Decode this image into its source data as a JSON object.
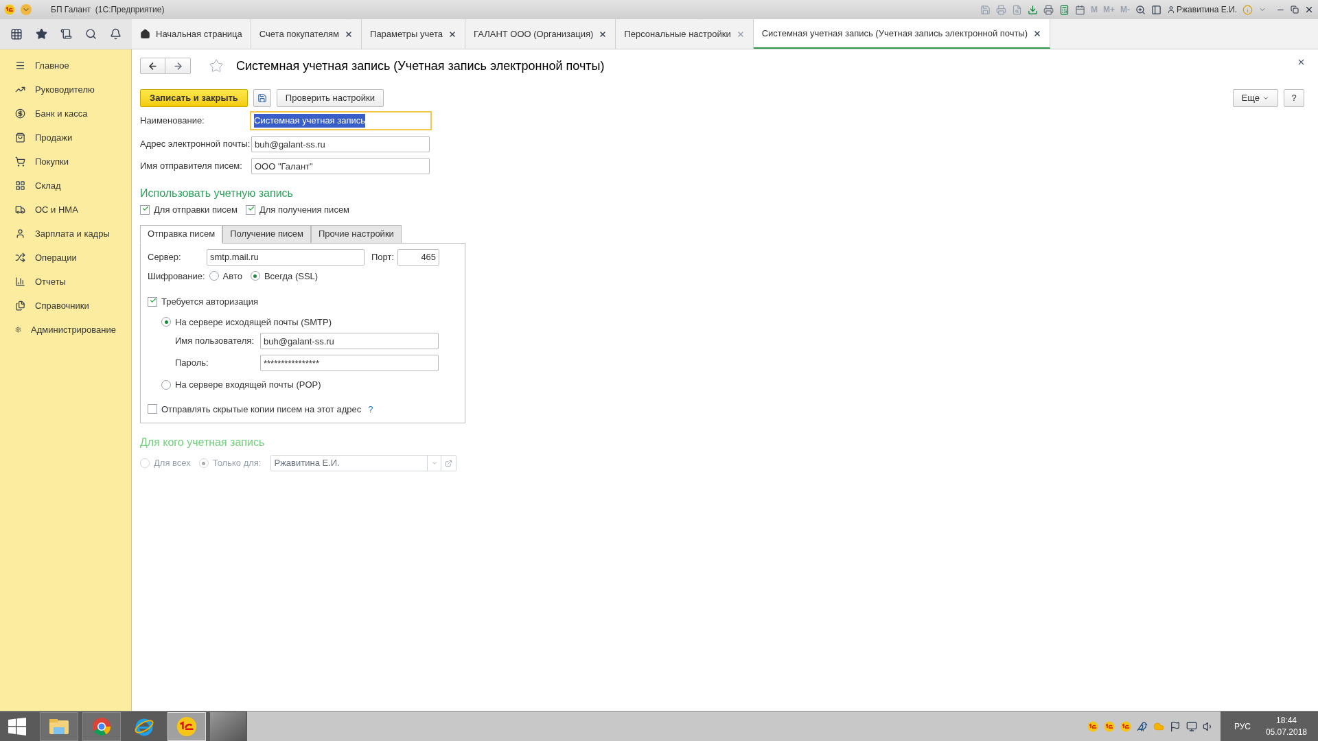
{
  "window": {
    "title": "БП Галант  (1С:Предприятие)",
    "user": "Ржавитина Е.И.",
    "memory_buttons": [
      "M",
      "M+",
      "M-"
    ]
  },
  "tabs": [
    {
      "kind": "home",
      "label": "Начальная страница",
      "selected": false
    },
    {
      "kind": "doc",
      "label": "Счета покупателям",
      "selected": false
    },
    {
      "kind": "doc",
      "label": "Параметры учета",
      "selected": false
    },
    {
      "kind": "doc",
      "label": "ГАЛАНТ ООО (Организация)",
      "selected": false
    },
    {
      "kind": "doc",
      "label": "Персональные настройки",
      "selected": false
    },
    {
      "kind": "doc",
      "label": "Системная учетная запись (Учетная запись электронной почты)",
      "selected": true
    }
  ],
  "sidebar": {
    "items": [
      {
        "label": "Главное"
      },
      {
        "label": "Руководителю"
      },
      {
        "label": "Банк и касса"
      },
      {
        "label": "Продажи"
      },
      {
        "label": "Покупки"
      },
      {
        "label": "Склад"
      },
      {
        "label": "ОС и НМА"
      },
      {
        "label": "Зарплата и кадры"
      },
      {
        "label": "Операции"
      },
      {
        "label": "Отчеты"
      },
      {
        "label": "Справочники"
      },
      {
        "label": "Администрирование"
      }
    ]
  },
  "form": {
    "title": "Системная учетная запись (Учетная запись электронной почты)",
    "buttons": {
      "save_close": "Записать и закрыть",
      "check": "Проверить настройки",
      "more": "Еще",
      "help": "?"
    },
    "fields": [
      {
        "label": "Наименование:",
        "value": "Системная учетная запись",
        "focused": true
      },
      {
        "label": "Адрес электронной почты:",
        "value": "buh@galant-ss.ru",
        "focused": false
      },
      {
        "label": "Имя отправителя писем:",
        "value": "ООО \"Галант\"",
        "focused": false
      }
    ],
    "use_section": {
      "title": "Использовать учетную запись",
      "options": [
        {
          "label": "Для отправки писем",
          "checked": true
        },
        {
          "label": "Для получения писем",
          "checked": true
        }
      ]
    },
    "inner_tabs": [
      {
        "label": "Отправка писем",
        "selected": true
      },
      {
        "label": "Получение писем",
        "selected": false
      },
      {
        "label": "Прочие настройки",
        "selected": false
      }
    ],
    "server": {
      "label": "Сервер:",
      "value": "smtp.mail.ru"
    },
    "port": {
      "label": "Порт:",
      "value": "465"
    },
    "encryption": {
      "label": "Шифрование:",
      "options": [
        {
          "label": "Авто",
          "selected": false
        },
        {
          "label": "Всегда (SSL)",
          "selected": true
        }
      ]
    },
    "auth": {
      "label": "Требуется авторизация",
      "checked": true,
      "modes": [
        {
          "label": "На сервере исходящей почты (SMTP)",
          "selected": true
        },
        {
          "label": "На сервере входящей почты (POP)",
          "selected": false
        }
      ],
      "username": {
        "label": "Имя пользователя:",
        "value": "buh@galant-ss.ru"
      },
      "password": {
        "label": "Пароль:",
        "value": "****************"
      }
    },
    "bcc": {
      "label": "Отправлять скрытые копии писем на этот адрес",
      "checked": false,
      "help": "?"
    },
    "owner_section": {
      "title": "Для кого учетная запись",
      "disabled": true,
      "options": [
        {
          "label": "Для всех",
          "selected": false
        },
        {
          "label": "Только для:",
          "selected": true
        }
      ],
      "value": "Ржавитина Е.И."
    }
  },
  "taskbar": {
    "language": "РУС",
    "time": "18:44",
    "date": "05.07.2018"
  }
}
